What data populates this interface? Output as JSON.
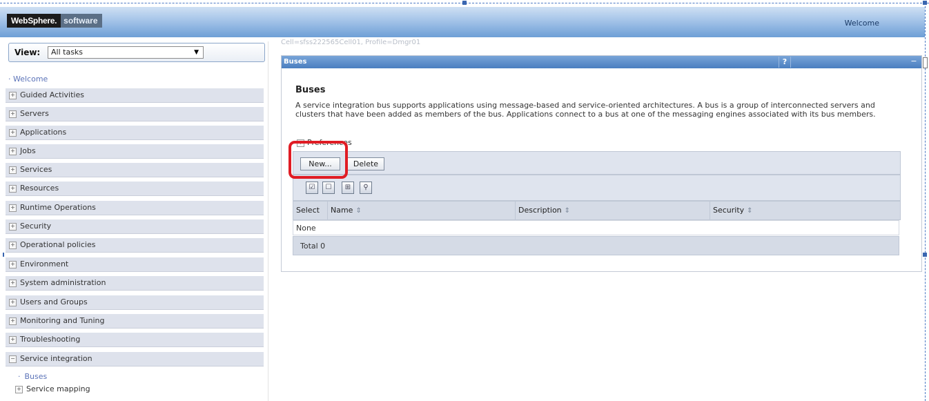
{
  "header": {
    "brand_primary": "WebSphere.",
    "brand_secondary": "software",
    "welcome": "Welcome"
  },
  "nav": {
    "views_label": "View:",
    "views_selected": "All tasks",
    "welcome_link": "Welcome",
    "items": [
      {
        "label": "Guided Activities",
        "state": "+"
      },
      {
        "label": "Servers",
        "state": "+"
      },
      {
        "label": "Applications",
        "state": "+"
      },
      {
        "label": "Jobs",
        "state": "+"
      },
      {
        "label": "Services",
        "state": "+"
      },
      {
        "label": "Resources",
        "state": "+"
      },
      {
        "label": "Runtime Operations",
        "state": "+"
      },
      {
        "label": "Security",
        "state": "+"
      },
      {
        "label": "Operational policies",
        "state": "+"
      },
      {
        "label": "Environment",
        "state": "+"
      },
      {
        "label": "System administration",
        "state": "+"
      },
      {
        "label": "Users and Groups",
        "state": "+"
      },
      {
        "label": "Monitoring and Tuning",
        "state": "+"
      },
      {
        "label": "Troubleshooting",
        "state": "+"
      },
      {
        "label": "Service integration",
        "state": "−"
      }
    ],
    "sub_items": [
      {
        "label": "Buses"
      },
      {
        "label": "Service mapping"
      }
    ]
  },
  "breadcrumb": "Cell=sfss222565Cell01, Profile=Dmgr01",
  "panel": {
    "bar_title": "Buses",
    "help": "?",
    "minimize": "−",
    "heading": "Buses",
    "description": "A service integration bus supports applications using message-based and service-oriented architectures. A bus is a group of interconnected servers and clusters that have been added as members of the bus. Applications connect to a bus at one of the messaging engines associated with its bus members.",
    "preferences": "Preferences",
    "buttons": {
      "new": "New...",
      "delete": "Delete"
    },
    "tool_icons": [
      "select-all-icon",
      "deselect-all-icon",
      "show-filter-icon",
      "clear-filter-icon"
    ],
    "table": {
      "columns": [
        "Select",
        "Name",
        "Description",
        "Security"
      ],
      "empty_text": "None",
      "total": "Total 0"
    }
  },
  "colors": {
    "highlight": "#e01c24",
    "header_blue": "#6e9fd6",
    "nav_item_bg": "#dee2ec"
  }
}
